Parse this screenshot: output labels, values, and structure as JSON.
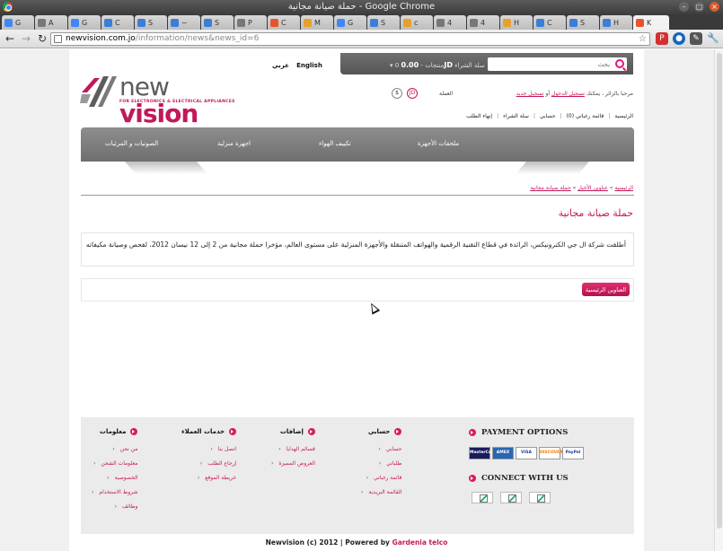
{
  "browser": {
    "window_title": "حملة صيانة مجانية - Google Chrome",
    "url_domain": "newvision.com.jo",
    "url_path": "/information/news&news_id=6",
    "tabs": [
      {
        "label": "G",
        "color": "#4285f4"
      },
      {
        "label": "A",
        "color": "#777777"
      },
      {
        "label": "G",
        "color": "#4285f4"
      },
      {
        "label": "C",
        "color": "#3b7dd8"
      },
      {
        "label": "S",
        "color": "#3b7dd8"
      },
      {
        "label": "~",
        "color": "#3b7dd8"
      },
      {
        "label": "S",
        "color": "#3b7dd8"
      },
      {
        "label": "P",
        "color": "#777777"
      },
      {
        "label": "C",
        "color": "#e8542a"
      },
      {
        "label": "M",
        "color": "#e8a02a"
      },
      {
        "label": "G",
        "color": "#4285f4"
      },
      {
        "label": "S",
        "color": "#3b7dd8"
      },
      {
        "label": "c",
        "color": "#e8a02a"
      },
      {
        "label": "4",
        "color": "#777777"
      },
      {
        "label": "4",
        "color": "#777777"
      },
      {
        "label": "H",
        "color": "#e8a02a"
      },
      {
        "label": "C",
        "color": "#3b7dd8"
      },
      {
        "label": "S",
        "color": "#3b7dd8"
      },
      {
        "label": "H",
        "color": "#3b7dd8"
      },
      {
        "label": "K",
        "color": "#e8542a"
      }
    ]
  },
  "header": {
    "lang_arabic": "عربي",
    "lang_english": "English",
    "cart_label": "سلة الشراء",
    "cart_amount": "0.00JD",
    "cart_products": "0 منتجات",
    "search_placeholder": "بحث",
    "welcome_text": "مرحبا بالزائر ، يمكنك",
    "login_link": "تسجيل الدخول",
    "or_text": "أو",
    "register_link": "تسجيل جديد",
    "currency_label": "العملة",
    "currency_jd": "JD",
    "currency_usd": "$",
    "logo_word1": "new",
    "logo_word2": "vision",
    "logo_tagline": "FOR ELECTRONICS & ELECTRICAL APPLIANCES",
    "top_links": [
      "الرئيسية",
      "قائمة رغباتي (0)",
      "حسابي",
      "سلة الشراء",
      "إنهاء الطلب"
    ]
  },
  "main_nav": [
    {
      "label": "ملحقات الأجهزة"
    },
    {
      "label": "تكييف الهواء"
    },
    {
      "label": "اجهزة منزلية"
    },
    {
      "label": "الصوتيات و المرئيات"
    }
  ],
  "content": {
    "breadcrumb": [
      "الرئيسية",
      "عناوين الأخبار",
      "حملة صيانة مجانية"
    ],
    "title": "حملة صيانة مجانية",
    "body": "أطلقت شركة ال جي الكترونيكس، الرائدة في قطاع التقنية الرقمية والهواتف المتنقلة والأجهزة المنزلية على مستوى العالم، مؤخرا حملة مجانية من 2 إلى 12 نيسان 2012، لفحص وصيانة مكيفاته",
    "back_button": "العناوين الرئيسية"
  },
  "footer": {
    "col_info": {
      "title": "معلومات",
      "links": [
        "من نحن",
        "معلومات الشحن",
        "الخصوصية",
        "شروط الاستخدام",
        "وظائف"
      ]
    },
    "col_service": {
      "title": "خدمات العملاء",
      "links": [
        "اتصل بنا",
        "إرجاع الطلب",
        "خريطة الموقع"
      ]
    },
    "col_extras": {
      "title": "إضافات",
      "links": [
        "قسائم الهدايا",
        "العروض المميزة"
      ]
    },
    "col_account": {
      "title": "حسابي",
      "links": [
        "حسابي",
        "طلباتي",
        "قائمة رغباتي",
        "القائمة البريدية"
      ]
    },
    "payment_title": "PAYMENT OPTIONS",
    "payment_cards": [
      {
        "label": "MasterCard",
        "color": "#1a1a5e"
      },
      {
        "label": "AMEX",
        "color": "#2867b2"
      },
      {
        "label": "VISA",
        "color": "#ffffff"
      },
      {
        "label": "DISCOVER",
        "color": "#f57c00"
      },
      {
        "label": "PayPal",
        "color": "#ffffff"
      }
    ],
    "connect_title": "CONNECT WITH US",
    "copyright_prefix": "Newvision (c) 2012 | Powered by",
    "copyright_brand": "Gardenia telco"
  },
  "colors": {
    "accent": "#c2185b",
    "nav_gray": "#7e7e7e"
  }
}
